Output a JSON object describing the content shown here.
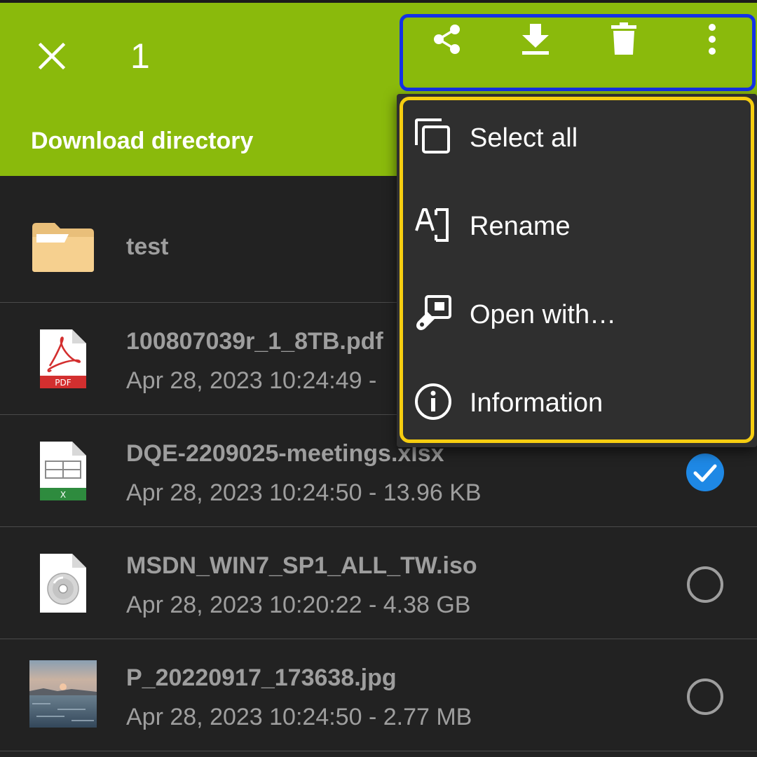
{
  "appbar": {
    "selected_count": "1",
    "directory_title": "Download directory",
    "color": "#8aba0c",
    "actions": [
      {
        "icon": "share-icon"
      },
      {
        "icon": "download-icon"
      },
      {
        "icon": "delete-icon"
      },
      {
        "icon": "more-vert-icon"
      }
    ]
  },
  "files": [
    {
      "name": "test",
      "meta": "",
      "icon": "folder-icon",
      "selected": null
    },
    {
      "name": "100807039r_1_8TB.pdf",
      "meta": "Apr 28, 2023 10:24:49 -",
      "icon": "pdf-file-icon",
      "badge": "PDF",
      "selected": null
    },
    {
      "name": "DQE-2209025-meetings.xlsx",
      "meta": "Apr 28, 2023 10:24:50 - 13.96 KB",
      "icon": "excel-file-icon",
      "badge": "X",
      "selected": true
    },
    {
      "name": "MSDN_WIN7_SP1_ALL_TW.iso",
      "meta": "Apr 28, 2023 10:20:22 - 4.38 GB",
      "icon": "disc-image-icon",
      "selected": false
    },
    {
      "name": "P_20220917_173638.jpg",
      "meta": "Apr 28, 2023 10:24:50 - 2.77 MB",
      "icon": "photo-thumbnail",
      "selected": false
    }
  ],
  "menu": {
    "items": [
      {
        "label": "Select all",
        "icon": "select-all-icon"
      },
      {
        "label": "Rename",
        "icon": "rename-icon"
      },
      {
        "label": "Open with…",
        "icon": "open-with-icon"
      },
      {
        "label": "Information",
        "icon": "info-icon"
      }
    ]
  },
  "colors": {
    "highlight_actions": "#1432e6",
    "highlight_menu": "#f6cd10",
    "checked": "#1e88e5"
  }
}
